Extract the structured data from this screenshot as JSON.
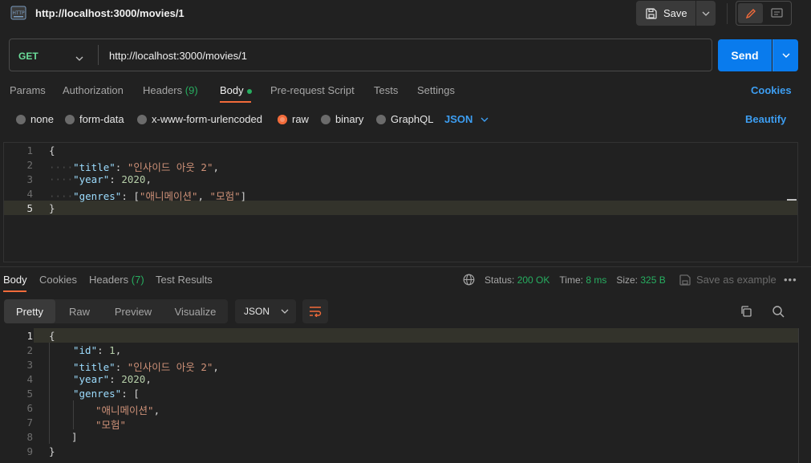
{
  "header": {
    "title": "http://localhost:3000/movies/1",
    "save_label": "Save"
  },
  "request": {
    "method": "GET",
    "url": "http://localhost:3000/movies/1",
    "send_label": "Send",
    "tabs": [
      "Params",
      "Authorization",
      "Headers",
      "Body",
      "Pre-request Script",
      "Tests",
      "Settings"
    ],
    "headers_count": "(9)",
    "cookies_label": "Cookies",
    "body_types": [
      "none",
      "form-data",
      "x-www-form-urlencoded",
      "raw",
      "binary",
      "GraphQL"
    ],
    "format": "JSON",
    "beautify_label": "Beautify",
    "line_numbers": [
      "1",
      "2",
      "3",
      "4",
      "5"
    ]
  },
  "response": {
    "tabs": [
      "Body",
      "Cookies",
      "Headers",
      "Test Results"
    ],
    "headers_count": "(7)",
    "status_label": "Status:",
    "status_value": "200 OK",
    "time_label": "Time:",
    "time_value": "8 ms",
    "size_label": "Size:",
    "size_value": "325 B",
    "save_example_label": "Save as example",
    "views": [
      "Pretty",
      "Raw",
      "Preview",
      "Visualize"
    ],
    "format": "JSON",
    "line_numbers": [
      "1",
      "2",
      "3",
      "4",
      "5",
      "6",
      "7",
      "8",
      "9"
    ]
  },
  "json": {
    "k_id": "\"id\"",
    "v_id": "1",
    "k_title": "\"title\"",
    "v_title": "\"인사이드 아웃 2\"",
    "k_year": "\"year\"",
    "v_year": "2020",
    "k_genres": "\"genres\"",
    "v_genre1": "\"애니메이션\"",
    "v_genre2": "\"모험\"",
    "brace_open": "{",
    "brace_close": "}",
    "bracket_open": "[",
    "bracket_close": "]",
    "colon": ": ",
    "comma": ",",
    "indent_dots": "····"
  },
  "colors": {
    "accent": "#f26b3a",
    "primary_button": "#097bed",
    "link": "#3d9ef2",
    "success": "#27ae60"
  }
}
